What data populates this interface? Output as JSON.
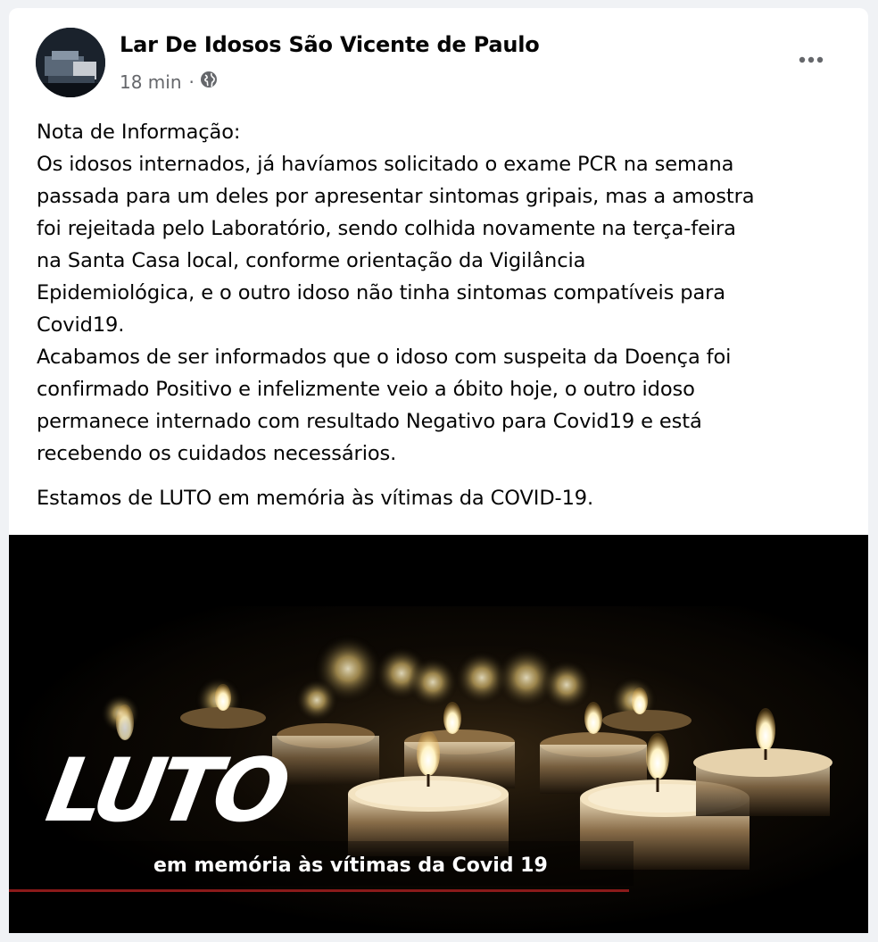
{
  "post": {
    "page_name": "Lar De Idosos São Vicente de Paulo",
    "time": "18 min",
    "separator": "·",
    "paragraphs": [
      "Nota de Informação:\nOs idosos internados, já havíamos solicitado o exame PCR na semana\npassada para um deles por apresentar sintomas gripais, mas a amostra\nfoi rejeitada pelo Laboratório, sendo colhida novamente na terça-feira\nna Santa Casa local, conforme orientação da Vigilância\nEpidemiológica, e o outro idoso não tinha sintomas compatíveis para\nCovid19.\nAcabamos de ser informados que o idoso com suspeita da Doença foi\nconfirmado Positivo e infelizmente veio a óbito hoje, o outro idoso\npermanece internado com resultado Negativo para Covid19 e está\nrecebendo os cuidados necessários.",
      "Estamos de LUTO em memória às vítimas da COVID-19."
    ]
  },
  "media": {
    "headline": "LUTO",
    "caption": "em memória às vítimas da Covid 19",
    "accent_line_color": "#8b1a1a"
  },
  "icons": {
    "privacy": "globe-icon",
    "menu": "more-options-icon"
  }
}
